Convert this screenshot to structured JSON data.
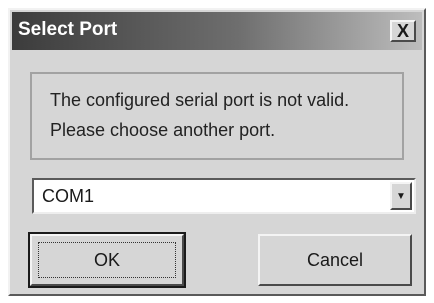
{
  "window": {
    "title": "Select Port",
    "close_label": "X"
  },
  "message": {
    "line1": "The configured serial port is not valid.",
    "line2": "Please choose another port."
  },
  "port_select": {
    "value": "COM1"
  },
  "buttons": {
    "ok": "OK",
    "cancel": "Cancel"
  }
}
